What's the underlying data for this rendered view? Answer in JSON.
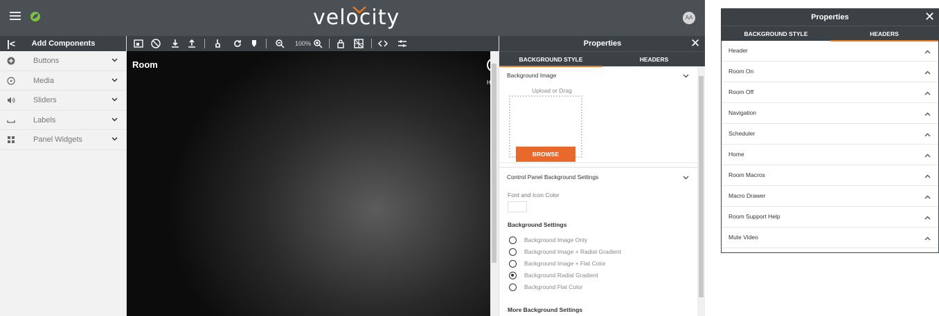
{
  "app": {
    "brand": "velocity",
    "user_initials": "AA"
  },
  "left_panel": {
    "title": "Add Components",
    "items": [
      {
        "label": "Buttons",
        "icon": "plus-circle-icon"
      },
      {
        "label": "Media",
        "icon": "play-circle-icon"
      },
      {
        "label": "Sliders",
        "icon": "volume-icon"
      },
      {
        "label": "Labels",
        "icon": "label-icon"
      },
      {
        "label": "Panel Widgets",
        "icon": "widgets-icon"
      }
    ]
  },
  "toolbar": {
    "zoom": "100%"
  },
  "canvas": {
    "room_title": "Room",
    "partial_label": "H"
  },
  "properties": {
    "title": "Properties",
    "tabs": [
      "BACKGROUND STYLE",
      "HEADERS"
    ],
    "active_tab": "BACKGROUND STYLE",
    "background_image": {
      "title": "Background Image",
      "upload_text": "Upload or Drag",
      "browse_label": "BROWSE"
    },
    "control_panel": {
      "title": "Control Panel Background Settings",
      "font_icon_color_label": "Font and Icon Color",
      "font_icon_color": "#ffffff",
      "background_settings_title": "Background Settings",
      "options": [
        "Background Image Only",
        "Background Image + Radial Gradient",
        "Background Image + Flat Color",
        "Background Radial Gradient",
        "Background Flat Color"
      ],
      "selected_option": "Background Radial Gradient",
      "more_settings_title": "More Background Settings"
    }
  },
  "properties_headers": {
    "title": "Properties",
    "tabs": [
      "BACKGROUND STYLE",
      "HEADERS"
    ],
    "active_tab": "HEADERS",
    "headers": [
      "Header",
      "Room On",
      "Room Off",
      "Navigation",
      "Scheduler",
      "Home",
      "Room Macros",
      "Macro Drawer",
      "Room Support Help",
      "Mute Video"
    ]
  },
  "colors": {
    "topbar": "#4a5053",
    "panel_header": "#3b4144",
    "accent": "#e8692b",
    "tab_underline": "#e87722",
    "leaf_green": "#7ac143"
  }
}
